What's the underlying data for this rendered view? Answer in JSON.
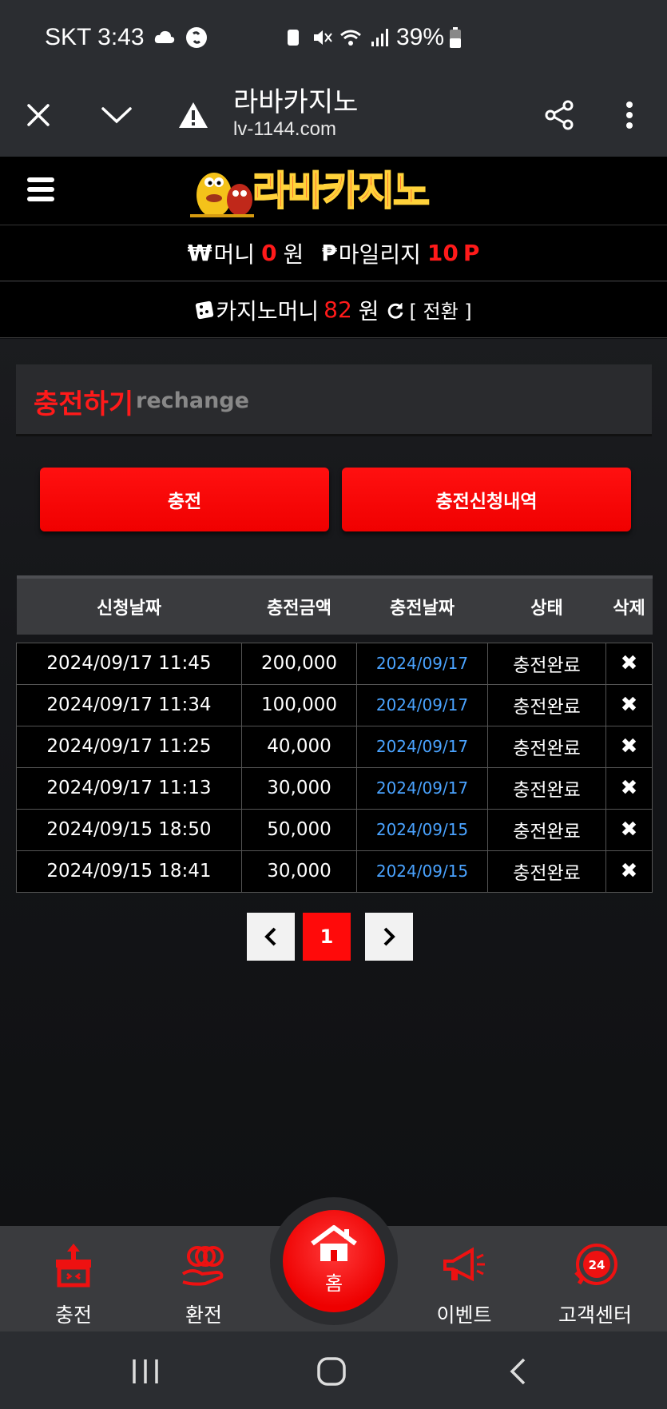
{
  "status_bar": {
    "carrier_time": "SKT 3:43",
    "battery": "39%",
    "icons": [
      "cloud-icon",
      "shazam-icon",
      "recycle-icon",
      "mute-icon",
      "wifi-icon",
      "signal-icon",
      "battery-icon"
    ]
  },
  "browser": {
    "title": "라바카지노",
    "url": "lv-1144.com",
    "icons": [
      "close-icon",
      "chevron-down-icon",
      "warning-icon",
      "share-icon",
      "more-icon"
    ]
  },
  "site": {
    "logo_text": "라바카지노",
    "money": {
      "symbol": "₩",
      "label": "머니",
      "value": "0",
      "unit": "원"
    },
    "mileage": {
      "symbol": "₱",
      "label": "마일리지",
      "value": "10",
      "unit": "P"
    },
    "casino": {
      "label": "카지노머니",
      "value": "82",
      "unit": "원",
      "switch_label": "[ 전환 ]"
    }
  },
  "panel": {
    "title_ko": "충전하기",
    "title_en": "rechange"
  },
  "buttons": {
    "charge": "충전",
    "history": "충전신청내역"
  },
  "table": {
    "headers": [
      "신청날짜",
      "충전금액",
      "충전날짜",
      "상태",
      "삭제"
    ],
    "rows": [
      {
        "request": "2024/09/17 11:45",
        "amount": "200,000",
        "date": "2024/09/17",
        "status": "충전완료",
        "delete": "✖"
      },
      {
        "request": "2024/09/17 11:34",
        "amount": "100,000",
        "date": "2024/09/17",
        "status": "충전완료",
        "delete": "✖"
      },
      {
        "request": "2024/09/17 11:25",
        "amount": "40,000",
        "date": "2024/09/17",
        "status": "충전완료",
        "delete": "✖"
      },
      {
        "request": "2024/09/17 11:13",
        "amount": "30,000",
        "date": "2024/09/17",
        "status": "충전완료",
        "delete": "✖"
      },
      {
        "request": "2024/09/15 18:50",
        "amount": "50,000",
        "date": "2024/09/15",
        "status": "충전완료",
        "delete": "✖"
      },
      {
        "request": "2024/09/15 18:41",
        "amount": "30,000",
        "date": "2024/09/15",
        "status": "충전완료",
        "delete": "✖"
      }
    ]
  },
  "pagination": {
    "prev": "‹",
    "current": "1",
    "next": "›"
  },
  "bottom_nav": {
    "charge": "충전",
    "exchange": "환전",
    "home": "홈",
    "event": "이벤트",
    "support": "고객센터"
  },
  "colors": {
    "accent": "#ff0a0a",
    "link_blue": "#4aa3ff",
    "header_bg": "#000000",
    "panel_bg": "#2a2b2e"
  }
}
